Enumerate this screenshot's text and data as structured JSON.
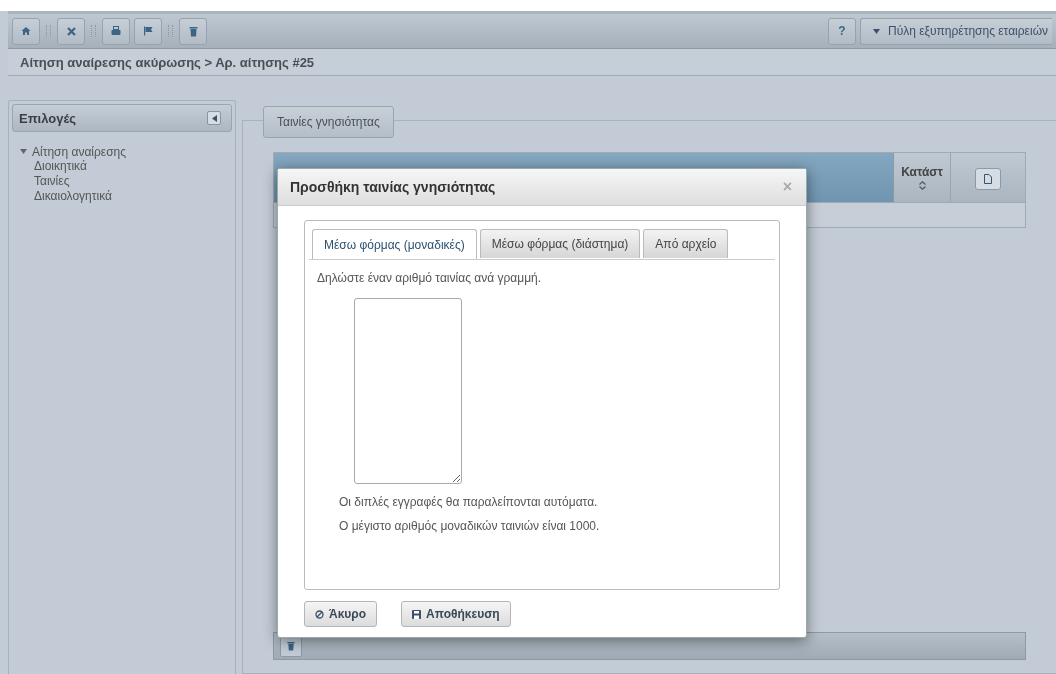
{
  "toolbar": {
    "help": "?",
    "portal_menu": "Πύλη εξυπηρέτησης εταιρειών"
  },
  "breadcrumb": "Αίτηση αναίρεσης ακύρωσης > Αρ. αίτησης #25",
  "sidebar": {
    "title": "Επιλογές",
    "items": [
      {
        "label": "Αίτηση αναίρεσης",
        "expanded": true,
        "children": [
          {
            "label": "Διοικητικά"
          },
          {
            "label": "Ταινίες"
          },
          {
            "label": "Δικαιολογητικά"
          }
        ]
      }
    ]
  },
  "panel": {
    "legend": "Ταινίες γνησιότητας",
    "table": {
      "columns": [
        "Κατάστ"
      ]
    }
  },
  "dialog": {
    "title": "Προσθήκη ταινίας γνησιότητας",
    "close": "×",
    "tabs": [
      {
        "label": "Μέσω φόρμας (μοναδικές)",
        "selected": true
      },
      {
        "label": "Μέσω φόρμας (διάστημα)",
        "selected": false
      },
      {
        "label": "Από αρχείο",
        "selected": false
      }
    ],
    "instruction": "Δηλώστε έναν αριθμό ταινίας ανά γραμμή.",
    "notes": [
      "Οι διπλές εγγραφές θα παραλείπονται αυτόματα.",
      "Ο μέγιστο αριθμός μοναδικών ταινιών είναι 1000."
    ],
    "buttons": [
      {
        "kind": "cancel",
        "label": "Άκυρο"
      },
      {
        "kind": "save",
        "label": "Αποθήκευση"
      }
    ]
  }
}
